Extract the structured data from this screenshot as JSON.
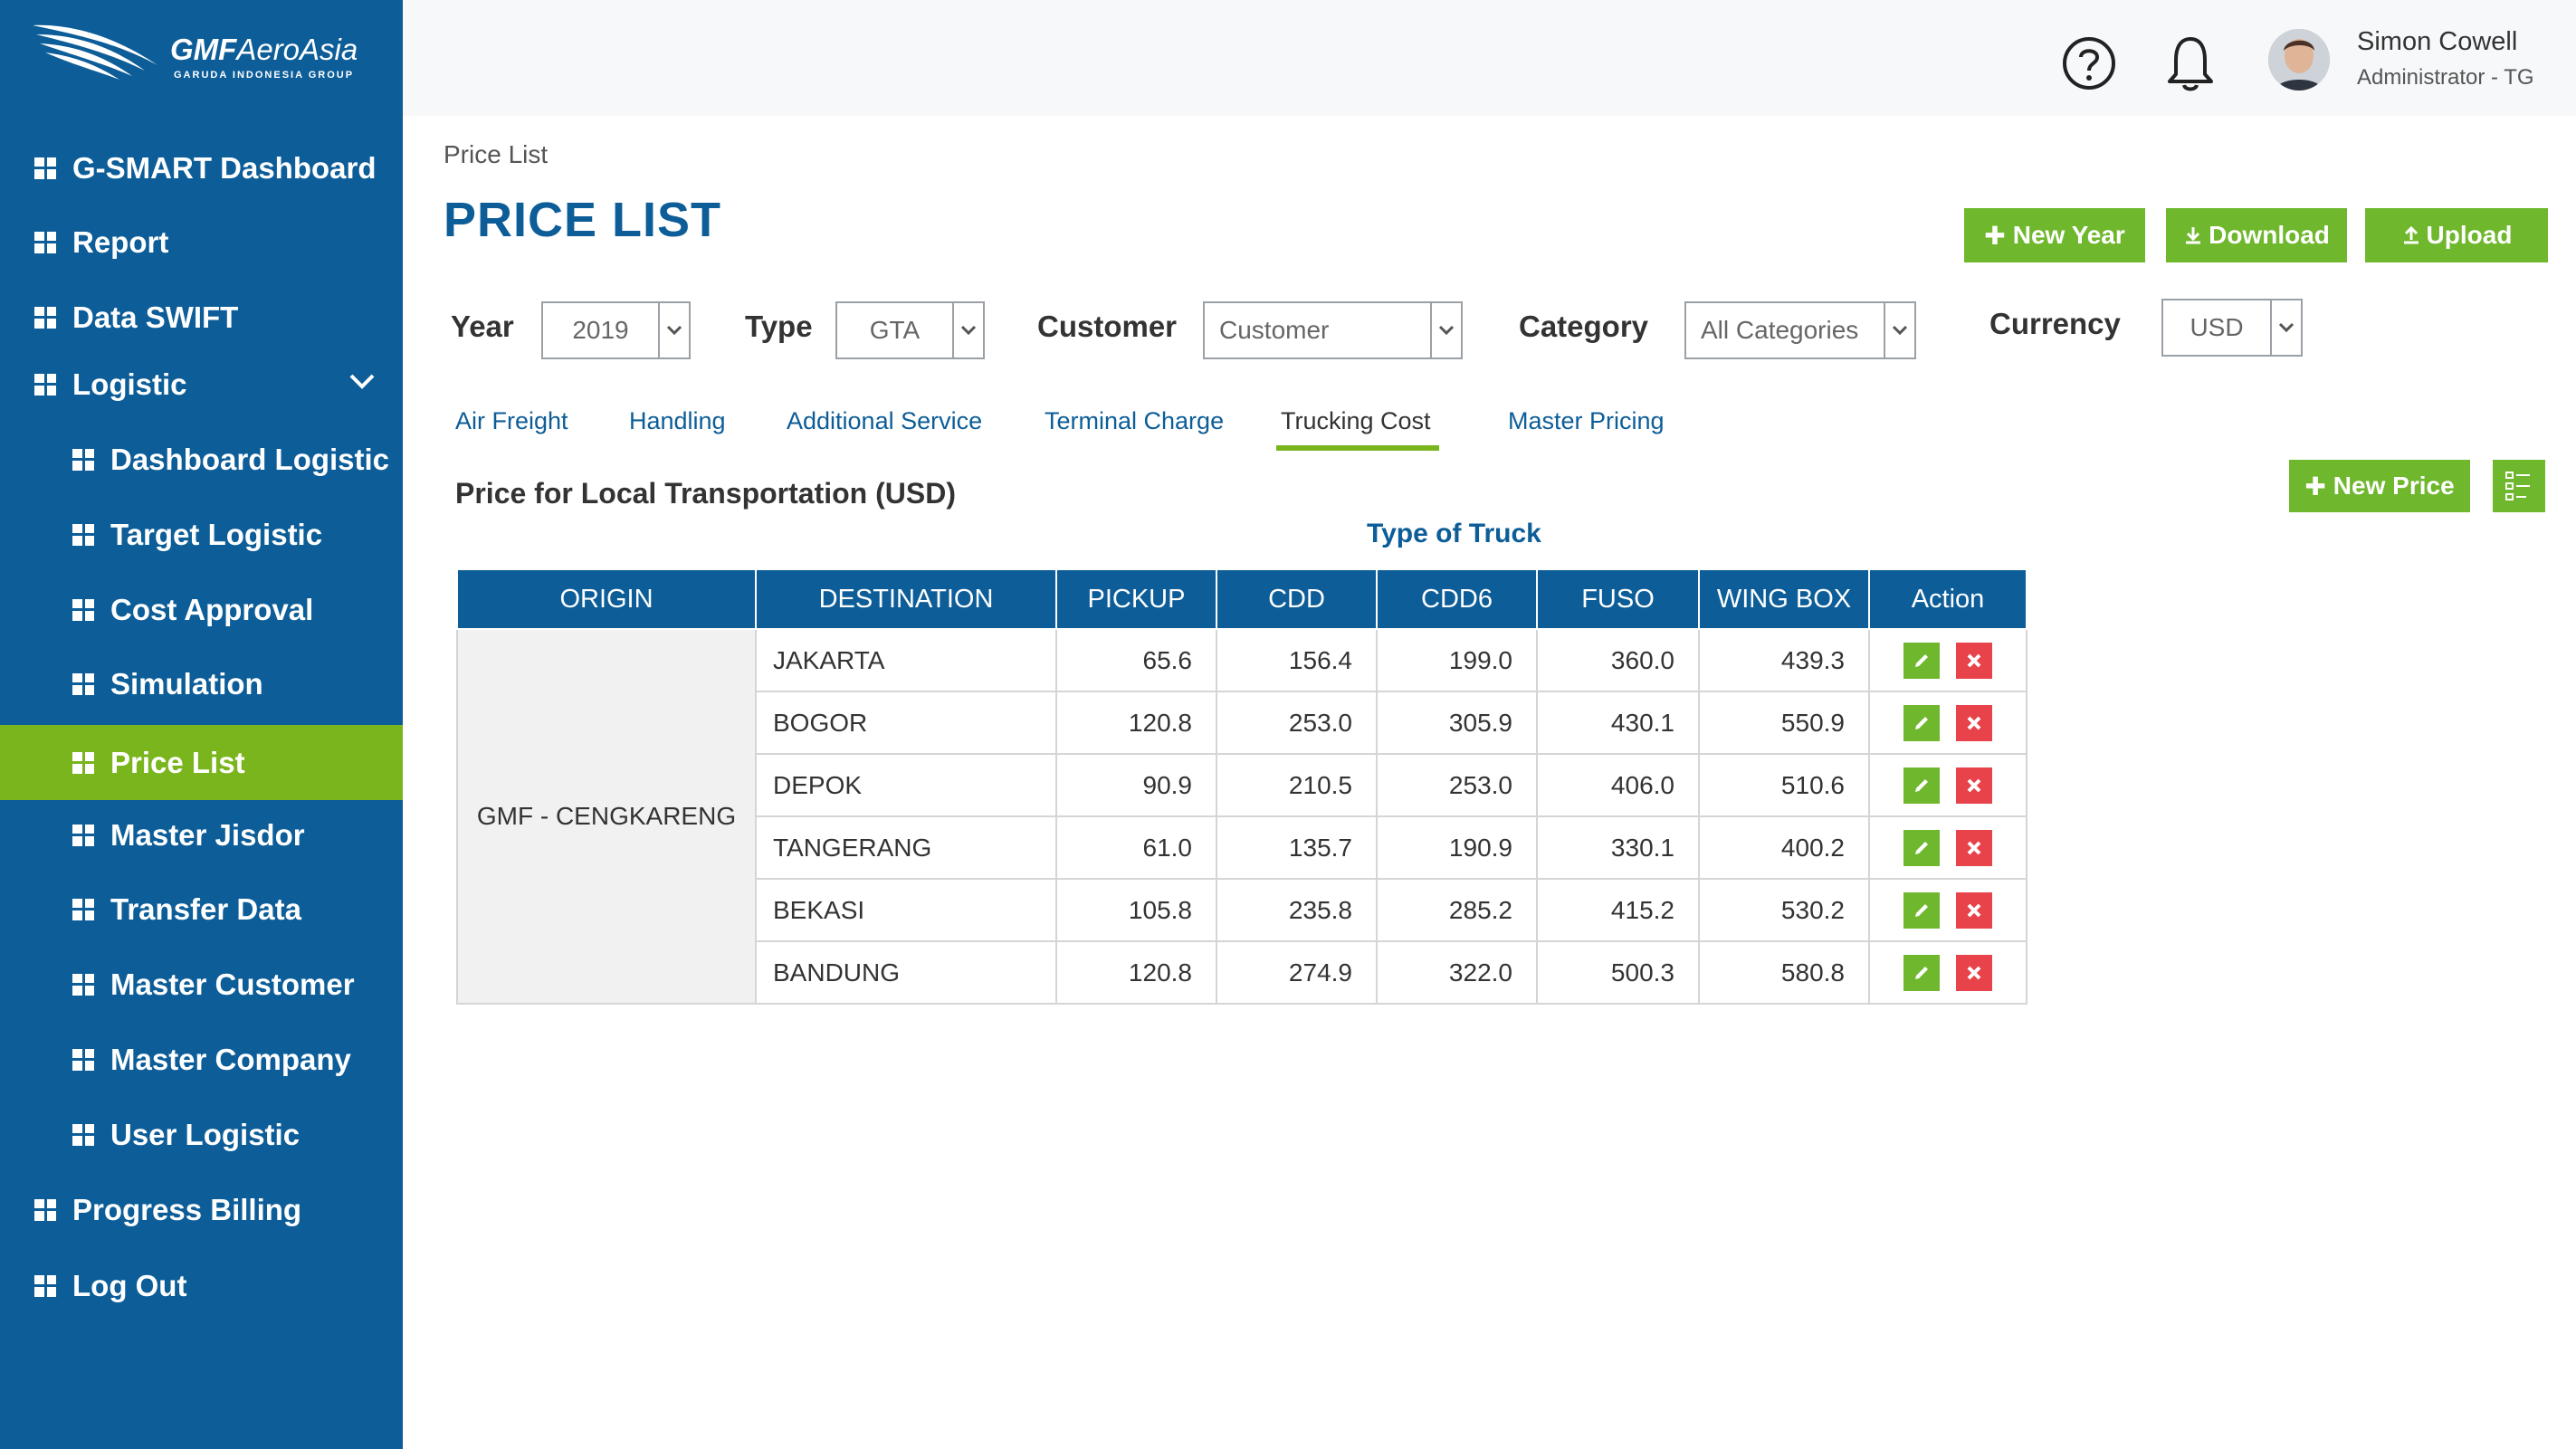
{
  "brand": {
    "name_bold": "GMF",
    "name_rest": "AeroAsia",
    "tagline": "GARUDA INDONESIA GROUP"
  },
  "sidebar": {
    "items": [
      {
        "label": "G-SMART Dashboard"
      },
      {
        "label": "Report"
      },
      {
        "label": "Data SWIFT"
      },
      {
        "label": "Logistic"
      },
      {
        "label": "Dashboard Logistic"
      },
      {
        "label": "Target Logistic"
      },
      {
        "label": "Cost Approval"
      },
      {
        "label": "Simulation"
      },
      {
        "label": "Price List",
        "active": true
      },
      {
        "label": "Master Jisdor"
      },
      {
        "label": "Transfer Data"
      },
      {
        "label": "Master Customer"
      },
      {
        "label": "Master Company"
      },
      {
        "label": "User Logistic"
      },
      {
        "label": "Progress Billing"
      },
      {
        "label": "Log Out"
      }
    ]
  },
  "header": {
    "user_name": "Simon Cowell",
    "user_role": "Administrator - TG"
  },
  "breadcrumb": "Price List",
  "page_title": "PRICE LIST",
  "actions": {
    "new_year": "New Year",
    "download": "Download",
    "upload": "Upload"
  },
  "filters": {
    "year": {
      "label": "Year",
      "value": "2019"
    },
    "type": {
      "label": "Type",
      "value": "GTA"
    },
    "customer": {
      "label": "Customer",
      "value": "Customer"
    },
    "category": {
      "label": "Category",
      "value": "All Categories"
    },
    "currency": {
      "label": "Currency",
      "value": "USD"
    }
  },
  "tabs": [
    {
      "label": "Air Freight"
    },
    {
      "label": "Handling"
    },
    {
      "label": "Additional Service"
    },
    {
      "label": "Terminal Charge"
    },
    {
      "label": "Trucking Cost",
      "active": true
    },
    {
      "label": "Master Pricing"
    }
  ],
  "section": {
    "title": "Price for Local Transportation (USD)",
    "new_price": "New Price",
    "truck_title": "Type of Truck"
  },
  "table": {
    "headers": [
      "ORIGIN",
      "DESTINATION",
      "PICKUP",
      "CDD",
      "CDD6",
      "FUSO",
      "WING BOX",
      "Action"
    ],
    "origin": "GMF - CENGKARENG",
    "rows": [
      [
        "JAKARTA",
        "65.6",
        "156.4",
        "199.0",
        "360.0",
        "439.3"
      ],
      [
        "BOGOR",
        "120.8",
        "253.0",
        "305.9",
        "430.1",
        "550.9"
      ],
      [
        "DEPOK",
        "90.9",
        "210.5",
        "253.0",
        "406.0",
        "510.6"
      ],
      [
        "TANGERANG",
        "61.0",
        "135.7",
        "190.9",
        "330.1",
        "400.2"
      ],
      [
        "BEKASI",
        "105.8",
        "235.8",
        "285.2",
        "415.2",
        "530.2"
      ],
      [
        "BANDUNG",
        "120.8",
        "274.9",
        "322.0",
        "500.3",
        "580.8"
      ]
    ]
  },
  "colors": {
    "primary": "#0c5d98",
    "accent": "#7ab51d",
    "button": "#6fb72d",
    "danger": "#e8424a"
  }
}
